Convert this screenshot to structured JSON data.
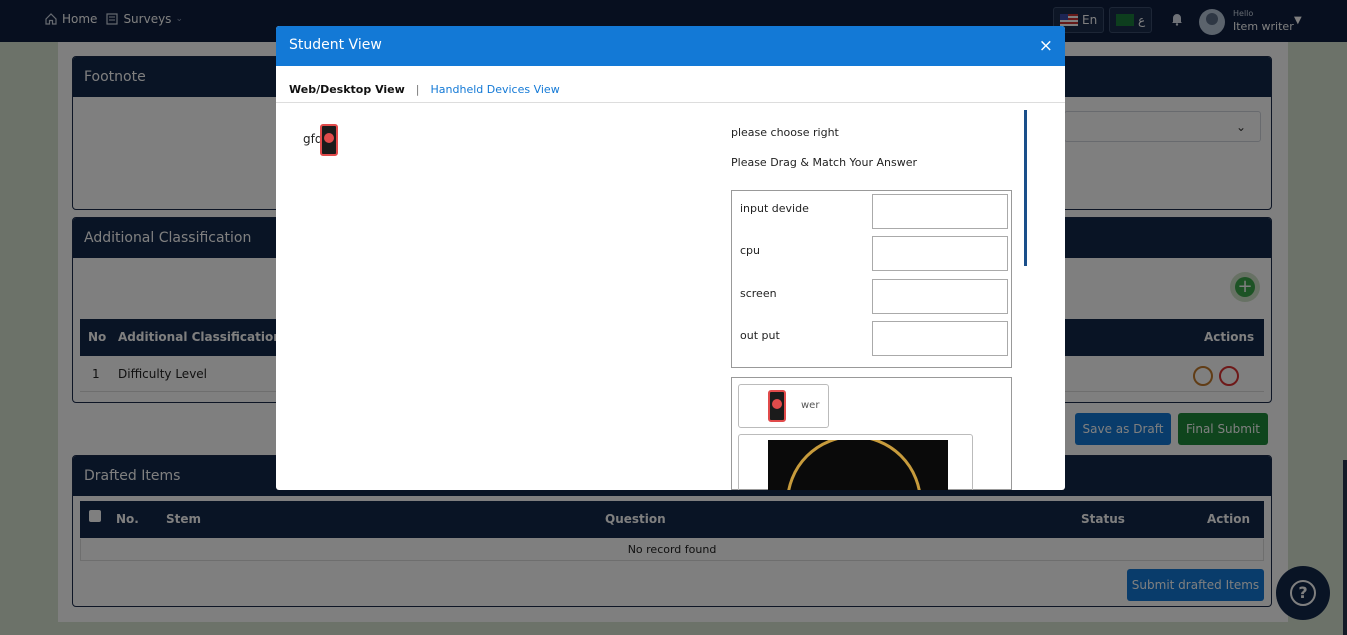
{
  "topbar": {
    "nav": {
      "home": "Home",
      "surveys": "Surveys"
    },
    "lang_en": "En",
    "lang_ar": "ع",
    "hello": "Hello",
    "user_name": "Item writer"
  },
  "page": {
    "footnote_title": "Footnote",
    "additional_classification_title": "Additional Classification",
    "ac_table": {
      "headers": {
        "no": "No",
        "classification": "Additional Classification",
        "actions": "Actions"
      },
      "rows": [
        {
          "no": "1",
          "classification": "Difficulty Level"
        }
      ]
    },
    "buttons": {
      "save_draft": "Save as Draft",
      "final_submit": "Final Submit",
      "submit_drafted": "Submit drafted Items"
    },
    "drafted_title": "Drafted Items",
    "drafted_table": {
      "headers": {
        "no": "No.",
        "stem": "Stem",
        "question": "Question",
        "status": "Status",
        "action": "Action"
      },
      "empty": "No record found"
    },
    "help": "?"
  },
  "modal": {
    "title": "Student View",
    "close": "×",
    "tabs": {
      "web": "Web/Desktop View",
      "separator": "|",
      "handheld": "Handheld Devices View"
    },
    "stem_text": "gfd",
    "instruction1": "please choose right",
    "instruction2": "Please Drag & Match Your Answer",
    "match_items": [
      "input devide",
      "cpu",
      "screen",
      "out put"
    ],
    "drag_item_text": "wer"
  },
  "colors": {
    "navy": "#12284a",
    "modal_blue": "#1379d6",
    "save_blue": "#1379d6",
    "submit_green": "#1e8a3a"
  }
}
